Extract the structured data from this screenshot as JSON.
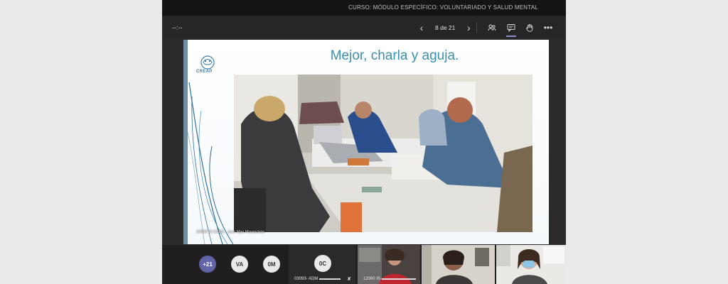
{
  "window": {
    "title": "CURSO: MÓDULO ESPECÍFICO: VOLUNTARIADO Y SALUD MENTAL"
  },
  "toolbar": {
    "timer": "--:--",
    "prev_icon": "chevron-left-icon",
    "next_icon": "chevron-right-icon",
    "page_label": "8 de 21",
    "icons": [
      "people-icon",
      "chat-icon",
      "raise-hand-icon",
      "more-icon"
    ]
  },
  "slide": {
    "title": "Mejor, charla y aguja.",
    "logo_text": "CREAP",
    "photo_caption": "12000 IS-CSBS - José Mas Moranchós",
    "accent_color": "#3a8fb0"
  },
  "participants": {
    "overflow_count": "+21",
    "avatars": [
      "VA",
      "0M"
    ],
    "tiles": [
      {
        "initials": "0C",
        "name": "03093- ADM ▬▬▬▬▬"
      },
      {
        "name": "12000 IS-▬▬▬▬▬▬▬▬"
      },
      {
        "name": ""
      },
      {
        "name": ""
      }
    ]
  }
}
